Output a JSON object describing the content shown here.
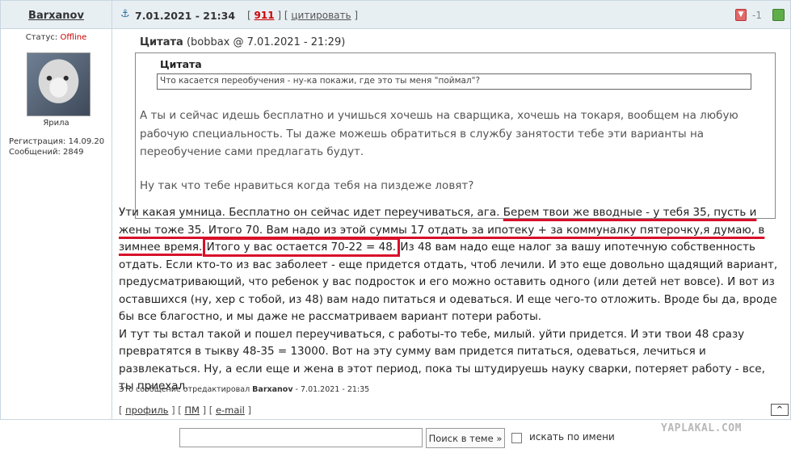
{
  "author": {
    "name": "Barxanov",
    "status_label": "Статус:",
    "status_value": "Offline",
    "avatar_caption": "Ярила",
    "registration": "Регистрация: 14.09.20",
    "messages": "Сообщений: 2849"
  },
  "header": {
    "anchor_icon": "anchor-icon",
    "date": "7.01.2021 - 21:34",
    "post_number": "911",
    "quote_link": "цитировать",
    "rating": "-1"
  },
  "quote": {
    "title_bold": "Цитата",
    "title_meta": "(bobbax @ 7.01.2021 - 21:29)",
    "inner_title": "Цитата",
    "inner_text": "Что касается переобучения - ну-ка покажи, где это ты меня \"поймал\"?",
    "para1": "А ты и сейчас идешь бесплатно и учишься хочешь на сварщика, хочешь на токаря, вообщем на любую рабочую специальность. Ты даже можешь обратиться в службу занятости тебе эти варианты на переобучение сами предлагать будут.",
    "para2": "Ну так что тебе нравиться когда тебя на пиздеже ловят?"
  },
  "body": {
    "p1_a": "Ути какая умница. Бесплатно он сейчас идет переучиваться, ага. ",
    "p1_hl": "Берем твои же вводные - у тебя 35, пусть и жены тоже 35. Итого 70. Вам надо из этой суммы 17 отдать за ипотеку + за коммуналку пятерочку,я думаю, в зимнее время.",
    "p1_box": "Итого у вас остается 70-22 = 48.",
    "p1_b": " Из 48 вам надо еще налог за вашу ипотечную собственность отдать. Если кто-то из вас заболеет - еще придется отдать, чтоб лечили. И это еще довольно щадящий вариант, предусматривающий, что ребенок у вас подросток и его можно оставить одного (или детей нет вовсе). И вот из оставшихся (ну, хер с тобой, из 48) вам надо питаться и одеваться. И еще чего-то отложить. Вроде бы да, вроде бы все благостно, и мы даже не рассматриваем вариант потери работы.",
    "p2": "И тут ты встал такой и пошел переучиваться, с работы-то тебе, милый. уйти придется. И эти твои 48 сразу превратятся в тыкву 48-35 = 13000. Вот на эту сумму вам придется питаться, одеваться, лечиться и развлекаться. Ну, а если еще и жена в этот период, пока ты штудируешь науку сварки, потеряет работу - все, ты приехал."
  },
  "edited": {
    "prefix": "Это сообщение отредактировал ",
    "name": "Barxanov",
    "suffix": " - 7.01.2021 - 21:35"
  },
  "footer": {
    "profile": "профиль",
    "pm": "ПМ",
    "email": "e-mail",
    "totop": "^"
  },
  "watermark": "YAPLAKAL.COM",
  "search": {
    "button": "Поиск в теме »",
    "checkbox_label": "искать по имени"
  }
}
